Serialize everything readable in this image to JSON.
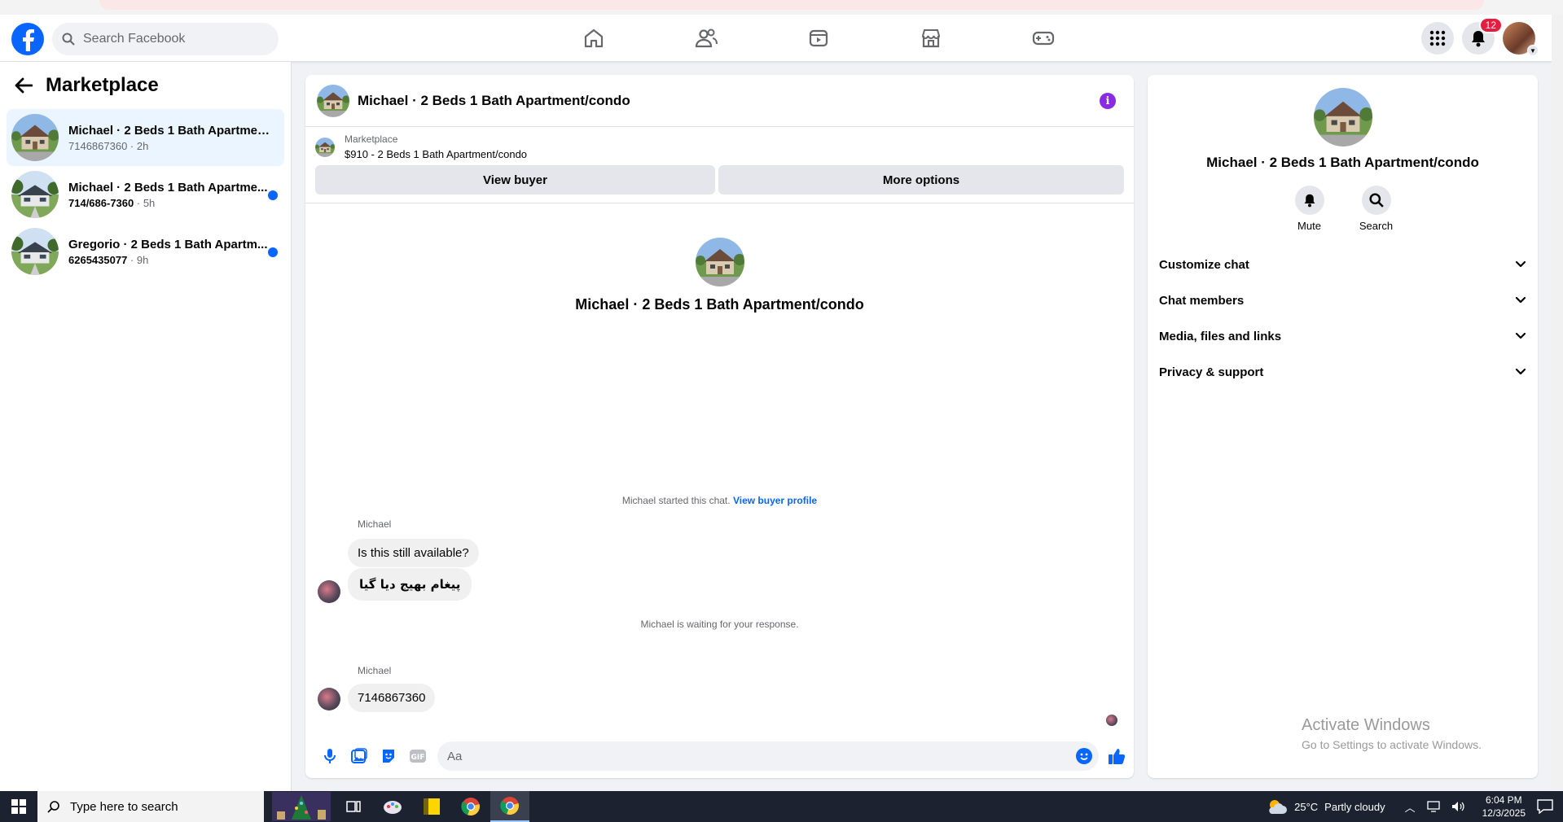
{
  "topnav": {
    "search_placeholder": "Search Facebook",
    "notifications_count": "12",
    "nav_icons": [
      "home-icon",
      "friends-icon",
      "video-icon",
      "marketplace-icon",
      "gaming-icon"
    ]
  },
  "sidebar": {
    "title": "Marketplace",
    "chats": [
      {
        "name": "Michael · 2 Beds 1 Bath Apartment...",
        "number": "7146867360",
        "time": "2h",
        "unread": false
      },
      {
        "name": "Michael · 2 Beds 1 Bath Apartme...",
        "number": "714/686-7360",
        "time": "5h",
        "unread": true
      },
      {
        "name": "Gregorio · 2 Beds 1 Bath Apartm...",
        "number": "6265435077",
        "time": "9h",
        "unread": true
      }
    ]
  },
  "chat": {
    "header_title": "Michael · 2 Beds 1 Bath Apartment/condo",
    "listing_label": "Marketplace",
    "listing_detail": "$910 - 2 Beds 1 Bath Apartment/condo",
    "view_buyer_label": "View buyer",
    "more_options_label": "More options",
    "intro_name": "Michael · 2 Beds 1 Bath Apartment/condo",
    "started_text": "Michael started this chat.",
    "view_profile_link": "View buyer profile",
    "sender1": "Michael",
    "msg1": "Is this still available?",
    "msg2": "پیغام بھیج دیا گیا",
    "waiting_text": "Michael is waiting for your response.",
    "sender2": "Michael",
    "msg3": "7146867360",
    "composer_placeholder": "Aa"
  },
  "info_panel": {
    "title": "Michael · 2 Beds 1 Bath Apartment/condo",
    "mute_label": "Mute",
    "search_label": "Search",
    "sections": [
      "Customize chat",
      "Chat members",
      "Media, files and links",
      "Privacy & support"
    ],
    "watermark_line1": "Activate Windows",
    "watermark_line2": "Go to Settings to activate Windows."
  },
  "taskbar": {
    "search_placeholder": "Type here to search",
    "temperature": "25°C",
    "weather": "Partly cloudy",
    "time": "6:04 PM",
    "date": "12/3/2025"
  },
  "colors": {
    "brand_blue": "#0866ff",
    "unread_dot": "#0866ff",
    "active_chat_bg": "#ebf5ff",
    "badge_red": "#e41e3f",
    "info_purple": "#8a2be2"
  }
}
